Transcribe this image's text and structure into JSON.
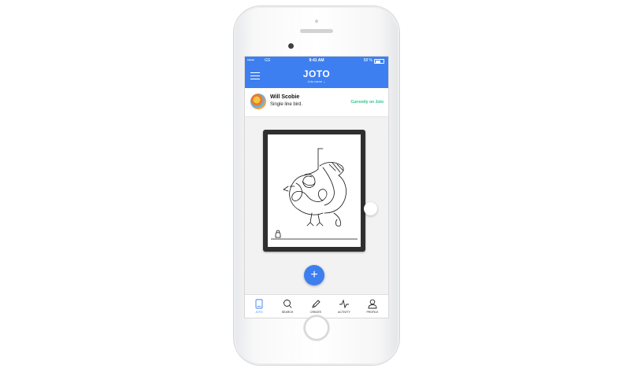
{
  "status_bar": {
    "signal": "•••••",
    "carrier": "GS",
    "time": "9:41 AM",
    "battery": "58 %"
  },
  "header": {
    "logo": "JOTO",
    "subtitle": "Joto name ⌄"
  },
  "user": {
    "name": "Will Scobie",
    "jot_title": "Single line bird.",
    "status": "Currently on Joto"
  },
  "fab": {
    "label": "+"
  },
  "tabs": [
    {
      "label": "JOTO",
      "icon": "joto-device-icon"
    },
    {
      "label": "SEARCH",
      "icon": "search-icon"
    },
    {
      "label": "CREATE",
      "icon": "pen-icon"
    },
    {
      "label": "ACTIVITY",
      "icon": "activity-icon"
    },
    {
      "label": "PROFILE",
      "icon": "profile-icon"
    }
  ],
  "colors": {
    "primary": "#3d7ff0",
    "status_green": "#2bc48a"
  }
}
